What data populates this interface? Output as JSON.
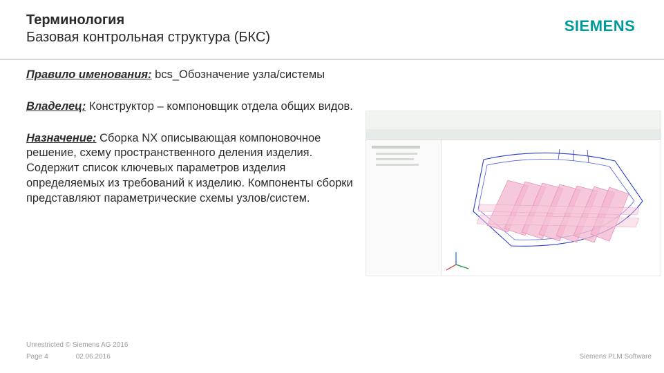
{
  "header": {
    "title": "Терминология",
    "subtitle": "Базовая контрольная структура (БКС)"
  },
  "logo": {
    "text": "SIEMENS"
  },
  "body": {
    "naming_label": "Правило именования:",
    "naming_value": " bcs_Обозначение узла/системы",
    "owner_label": "Владелец:",
    "owner_value": " Конструктор – компоновщик отдела общих видов.",
    "purpose_label": "Назначение:",
    "purpose_value": " Сборка NX описывающая компоновочное решение, схему пространственного деления изделия. Содержит список ключевых параметров изделия определяемых из требований к изделию.  Компоненты сборки представляют параметрические схемы узлов/систем."
  },
  "footer": {
    "copyright": "Unrestricted © Siemens AG 2016",
    "page": "Page 4",
    "date": "02.06.2016",
    "brand": "Siemens PLM Software"
  }
}
